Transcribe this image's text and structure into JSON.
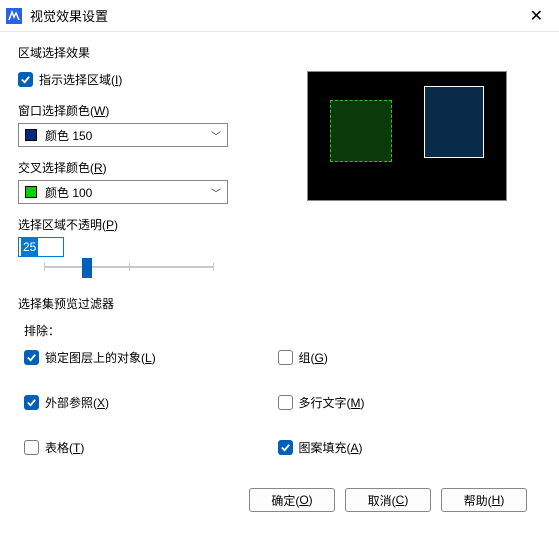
{
  "window": {
    "title": "视觉效果设置"
  },
  "section1": {
    "title": "区域选择效果",
    "indicate": {
      "label_pre": "指示选择区域(",
      "key": "I",
      "label_post": ")",
      "checked": true
    },
    "windowColor": {
      "label_pre": "窗口选择颜色(",
      "key": "W",
      "label_post": ")",
      "swatch": "#002a7a",
      "text": "颜色 150"
    },
    "crossColor": {
      "label_pre": "交叉选择颜色(",
      "key": "R",
      "label_post": ")",
      "swatch": "#00d000",
      "text": "颜色 100"
    },
    "opacity": {
      "label_pre": "选择区域不透明(",
      "key": "P",
      "label_post": ")",
      "value": "25",
      "percent": 25
    }
  },
  "section2": {
    "title": "选择集预览过滤器",
    "exclude": "排除：",
    "items": {
      "locked": {
        "label_pre": "锁定图层上的对象(",
        "key": "L",
        "label_post": ")",
        "checked": true
      },
      "group": {
        "label_pre": "组(",
        "key": "G",
        "label_post": ")",
        "checked": false
      },
      "xref": {
        "label_pre": "外部参照(",
        "key": "X",
        "label_post": ")",
        "checked": true
      },
      "mtext": {
        "label_pre": "多行文字(",
        "key": "M",
        "label_post": ")",
        "checked": false
      },
      "table": {
        "label_pre": "表格(",
        "key": "T",
        "label_post": ")",
        "checked": false
      },
      "hatch": {
        "label_pre": "图案填充(",
        "key": "A",
        "label_post": ")",
        "checked": true
      }
    }
  },
  "buttons": {
    "ok": {
      "pre": "确定(",
      "key": "O",
      "post": ")"
    },
    "cancel": {
      "pre": "取消(",
      "key": "C",
      "post": ")"
    },
    "help": {
      "pre": "帮助(",
      "key": "H",
      "post": ")"
    }
  }
}
